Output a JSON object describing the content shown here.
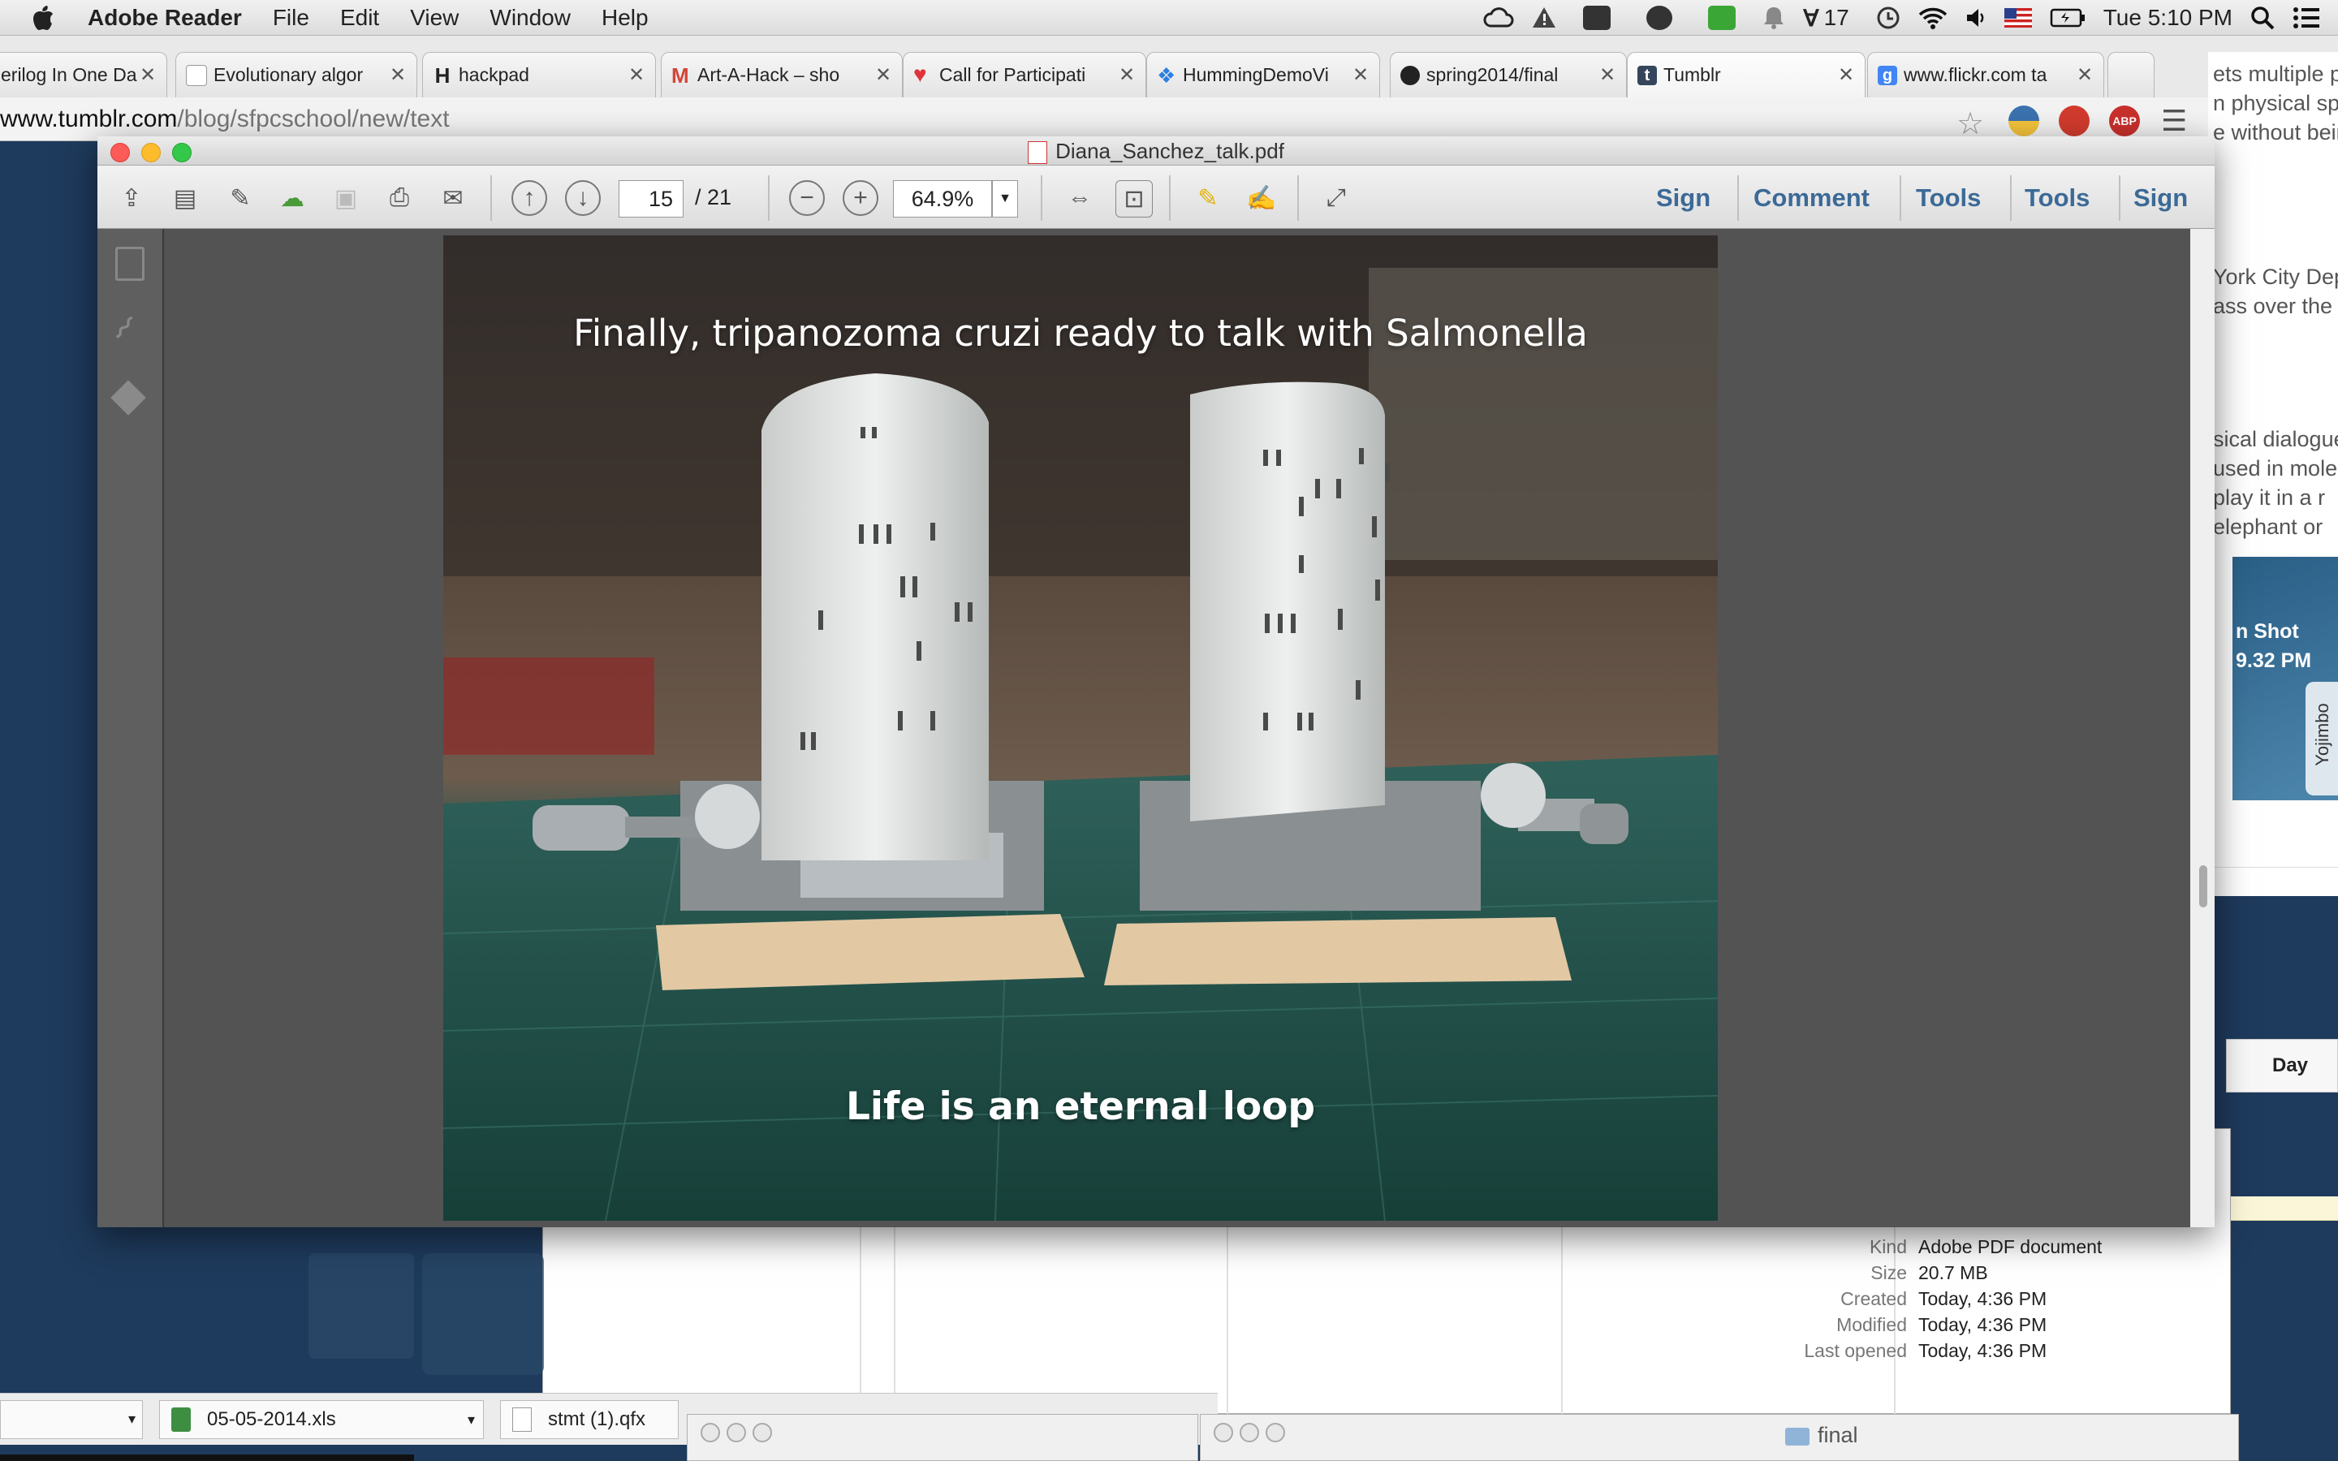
{
  "menubar": {
    "app": "Adobe Reader",
    "items": [
      "File",
      "Edit",
      "View",
      "Window",
      "Help"
    ],
    "status_count": "17",
    "clock": "Tue 5:10 PM"
  },
  "browser": {
    "tabs": [
      {
        "label": "erilog In One Da",
        "color": "#ffffff"
      },
      {
        "label": "Evolutionary algor",
        "color": "#ffffff"
      },
      {
        "label": "hackpad",
        "color": "#ffffff"
      },
      {
        "label": "Art-A-Hack – sho",
        "color": "#d44638"
      },
      {
        "label": "Call for Participati",
        "color": "#e0333a"
      },
      {
        "label": "HummingDemoVi",
        "color": "#2d7fe0"
      },
      {
        "label": "spring2014/final",
        "color": "#222222"
      },
      {
        "label": "Tumblr",
        "color": "#35465c"
      },
      {
        "label": "www.flickr.com ta",
        "color": "#4285f4"
      }
    ],
    "url_host": "www.tumblr.com",
    "url_path": "/blog/sfpcschool/new/text"
  },
  "background_window": {
    "lines": [
      "ets multiple pe",
      "n physical spac",
      "e without bein",
      "York City Dep",
      "ass over the c",
      "sical dialogue",
      "used in mole",
      "play it in a r",
      "elephant or",
      "n Shot",
      "9.32 PM",
      "Yojimbo",
      "Day"
    ]
  },
  "reader": {
    "filename": "Diana_Sanchez_talk.pdf",
    "page_current": "15",
    "page_total": "/ 21",
    "zoom": "64.9%",
    "links": [
      "Sign",
      "Comment",
      "Tools",
      "Tools",
      "Sign"
    ]
  },
  "slide": {
    "title": "Finally, tripanozoma cruzi ready to talk with Salmonella",
    "subtitle": "Life is an eternal loop"
  },
  "file_info": {
    "rows": [
      {
        "key": "Kind",
        "value": "Adobe PDF document"
      },
      {
        "key": "Size",
        "value": "20.7 MB"
      },
      {
        "key": "Created",
        "value": "Today, 4:36 PM"
      },
      {
        "key": "Modified",
        "value": "Today, 4:36 PM"
      },
      {
        "key": "Last opened",
        "value": "Today, 4:36 PM"
      }
    ]
  },
  "bottom": {
    "file1": "05-05-2014.xls",
    "file2": "stmt (1).qfx",
    "folder": "final"
  }
}
